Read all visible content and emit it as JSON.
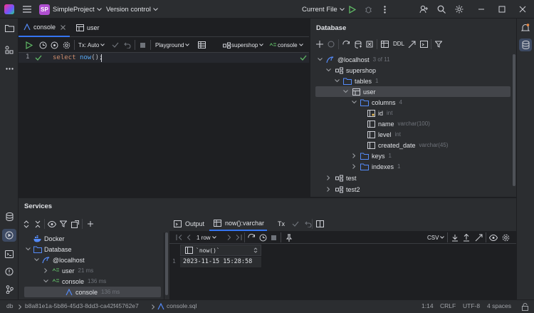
{
  "titlebar": {
    "project_badge": "SP",
    "project_name": "SimpleProject",
    "vcs": "Version control",
    "run_config": "Current File"
  },
  "editor": {
    "tabs": [
      {
        "label": "console",
        "active": true
      },
      {
        "label": "user",
        "active": false
      }
    ],
    "toolbar": {
      "tx": "Tx: Auto",
      "playground": "Playground",
      "schema": "supershop",
      "session": "console"
    },
    "line_number": "1",
    "code": {
      "kw": "select",
      "fn": "now",
      "rest": "();"
    }
  },
  "database": {
    "title": "Database",
    "toolbar_ddl": "DDL",
    "tree": [
      {
        "label": "@localhost",
        "hint": "3 of 11"
      },
      {
        "label": "supershop",
        "hint": ""
      },
      {
        "label": "tables",
        "hint": "1"
      },
      {
        "label": "user",
        "hint": ""
      },
      {
        "label": "columns",
        "hint": "4"
      },
      {
        "label": "id",
        "hint": "int"
      },
      {
        "label": "name",
        "hint": "varchar(100)"
      },
      {
        "label": "level",
        "hint": "int"
      },
      {
        "label": "created_date",
        "hint": "varchar(45)"
      },
      {
        "label": "keys",
        "hint": "1"
      },
      {
        "label": "indexes",
        "hint": "1"
      },
      {
        "label": "test",
        "hint": ""
      },
      {
        "label": "test2",
        "hint": ""
      }
    ]
  },
  "services": {
    "title": "Services",
    "tree": [
      {
        "label": "Docker",
        "hint": ""
      },
      {
        "label": "Database",
        "hint": ""
      },
      {
        "label": "@localhost",
        "hint": ""
      },
      {
        "label": "user",
        "hint": "21 ms"
      },
      {
        "label": "console",
        "hint": "136 ms"
      },
      {
        "label": "console",
        "hint": "136 ms"
      }
    ],
    "result_tabs": {
      "output": "Output",
      "result": "now():varchar",
      "tx": "Tx"
    },
    "rows_label": "1 row",
    "export_format": "CSV",
    "column_header": "`now()`",
    "row_number": "1",
    "cell_value": "2023-11-15 15:28:58"
  },
  "statusbar": {
    "db": "db",
    "path_id": "b8a81e1a-5b86-45d3-8dd3-ca42f45762e7",
    "file": "console.sql",
    "position": "1:14",
    "line_sep": "CRLF",
    "encoding": "UTF-8",
    "indent": "4 spaces"
  }
}
